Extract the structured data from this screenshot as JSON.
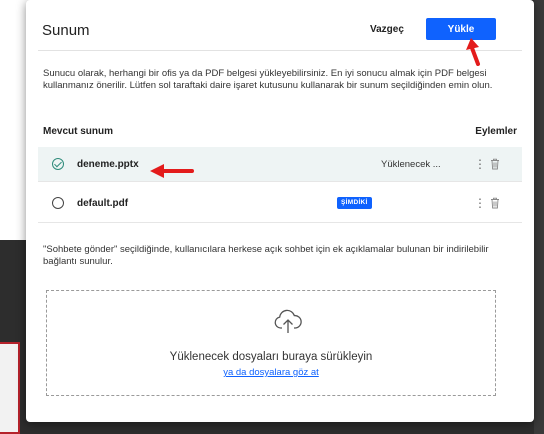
{
  "dialog": {
    "title": "Sunum",
    "cancel_label": "Vazgeç",
    "upload_label": "Yükle",
    "description": "Sunucu olarak, herhangi bir ofis ya da PDF belgesi yükleyebilirsiniz. En iyi sonucu almak için PDF belgesi kullanmanız önerilir. Lütfen sol taraftaki daire işaret kutusunu kullanarak bir sunum seçildiğinden emin olun."
  },
  "table": {
    "col_current": "Mevcut sunum",
    "col_actions": "Eylemler",
    "rows": [
      {
        "name": "deneme.pptx",
        "status": "Yüklenecek ...",
        "selected": true
      },
      {
        "name": "default.pdf",
        "badge": "ŞİMDİKİ",
        "selected": false
      }
    ]
  },
  "share_note": "\"Sohbete gönder\" seçildiğinde, kullanıcılara herkese açık sohbet için ek açıklamalar bulunan bir indirilebilir bağlantı sunulur.",
  "dropzone": {
    "text": "Yüklenecek dosyaları buraya sürükleyin",
    "browse_link": "ya da dosyalara göz at"
  },
  "colors": {
    "accent": "#0f62fe",
    "selected_row": "#eef4f4",
    "annotation_arrow": "#e31b1b"
  },
  "icons": [
    "check-circle-icon",
    "radio-empty-icon",
    "kebab-menu-icon",
    "trash-icon",
    "cloud-upload-icon",
    "annotation-arrow"
  ]
}
